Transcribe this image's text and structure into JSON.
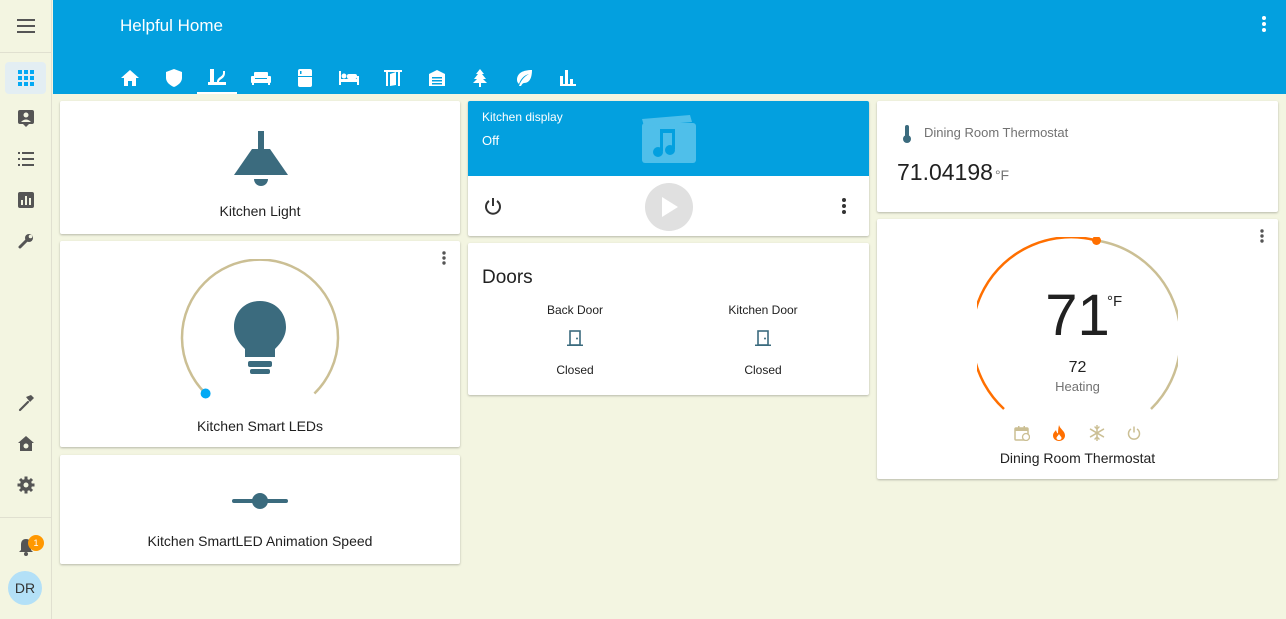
{
  "app": {
    "title": "Helpful Home"
  },
  "sidebar": {
    "notification_count": "1",
    "user_initials": "DR"
  },
  "cards": {
    "kitchen_light": {
      "name": "Kitchen Light"
    },
    "smart_leds": {
      "name": "Kitchen Smart LEDs",
      "brightness_fraction": 0
    },
    "animation_speed": {
      "name": "Kitchen SmartLED Animation Speed"
    },
    "kitchen_display": {
      "title": "Kitchen display",
      "state": "Off"
    },
    "doors": {
      "title": "Doors",
      "items": [
        {
          "name": "Back Door",
          "state": "Closed"
        },
        {
          "name": "Kitchen Door",
          "state": "Closed"
        }
      ]
    },
    "thermostat_sensor": {
      "name": "Dining Room Thermostat",
      "value": "71.04198",
      "unit": "°F"
    },
    "thermostat": {
      "name": "Dining Room Thermostat",
      "current_temp": "71",
      "unit": "°F",
      "target_temp": "72",
      "mode": "Heating"
    }
  },
  "colors": {
    "header": "#03a0df",
    "icon": "#3b6b7e",
    "heat": "#ff6f00",
    "dial_track": "#cbbf94",
    "accent_blue": "#03a9f4"
  }
}
